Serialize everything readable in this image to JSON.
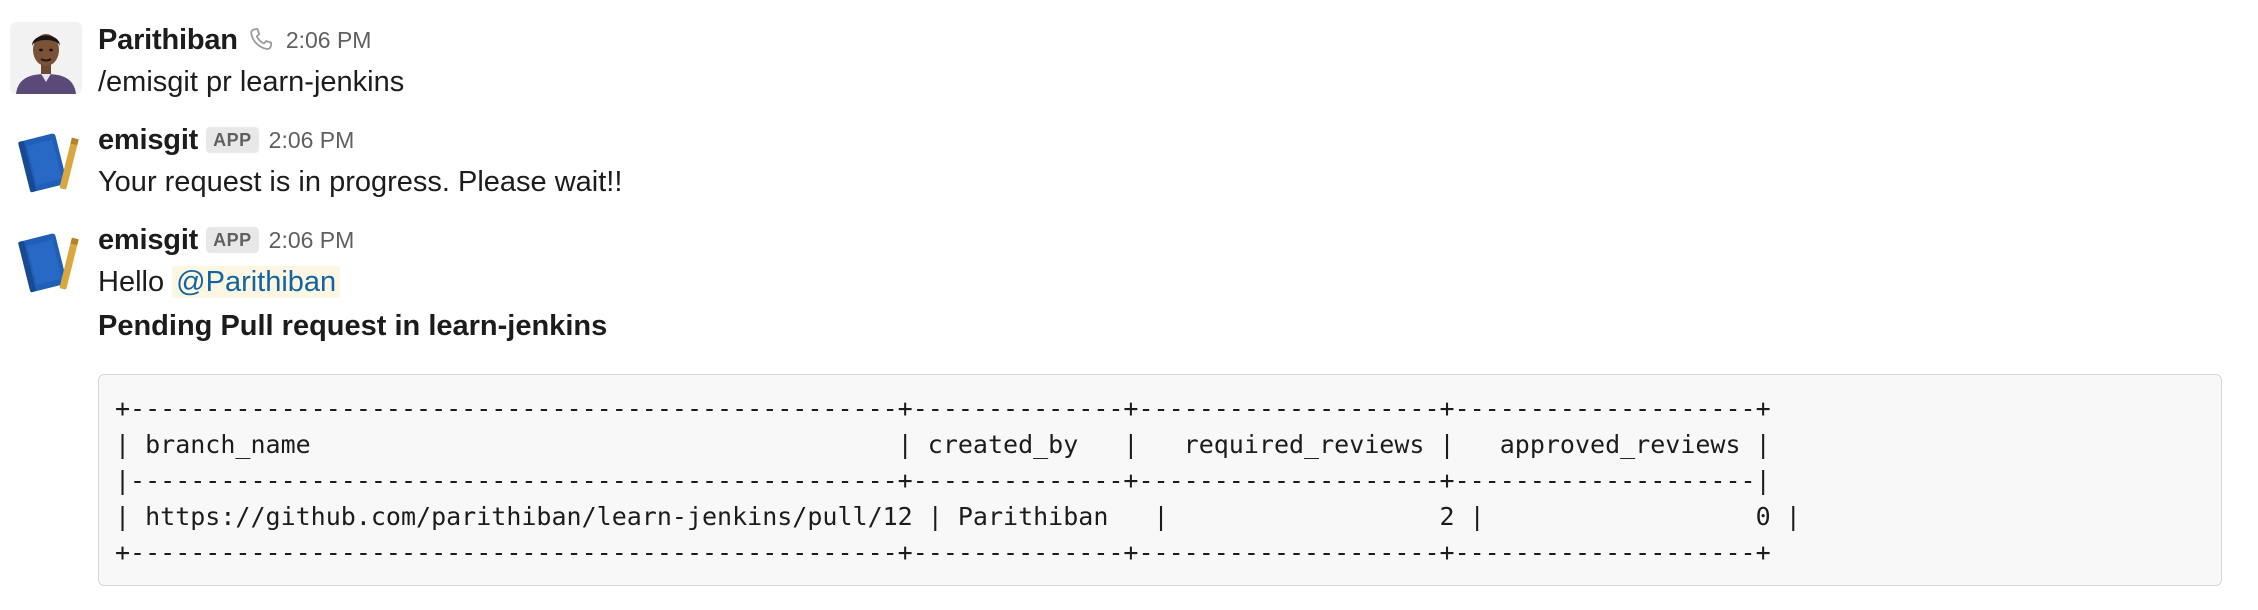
{
  "messages": [
    {
      "sender": "Parithiban",
      "icon": "phone-icon",
      "time": "2:06 PM",
      "text": "/emisgit pr learn-jenkins"
    },
    {
      "sender": "emisgit",
      "badge": "APP",
      "time": "2:06 PM",
      "text": "Your request is in progress. Please wait!!"
    },
    {
      "sender": "emisgit",
      "badge": "APP",
      "time": "2:06 PM",
      "greeting": "Hello",
      "mention": "@Parithiban",
      "heading": "Pending Pull request in learn-jenkins",
      "code_lines": [
        "+---------------------------------------------------+--------------+--------------------+--------------------+",
        "| branch_name                                       | created_by   |   required_reviews |   approved_reviews |",
        "|---------------------------------------------------+--------------+--------------------+--------------------|",
        "| https://github.com/parithiban/learn-jenkins/pull/12 | Parithiban   |                  2 |                  0 |",
        "+---------------------------------------------------+--------------+--------------------+--------------------+"
      ]
    }
  ],
  "colors": {
    "mention": "#1264a3",
    "mention_bg": "#fdf6e3",
    "time": "#616061",
    "code_bg": "#f8f8f8"
  }
}
